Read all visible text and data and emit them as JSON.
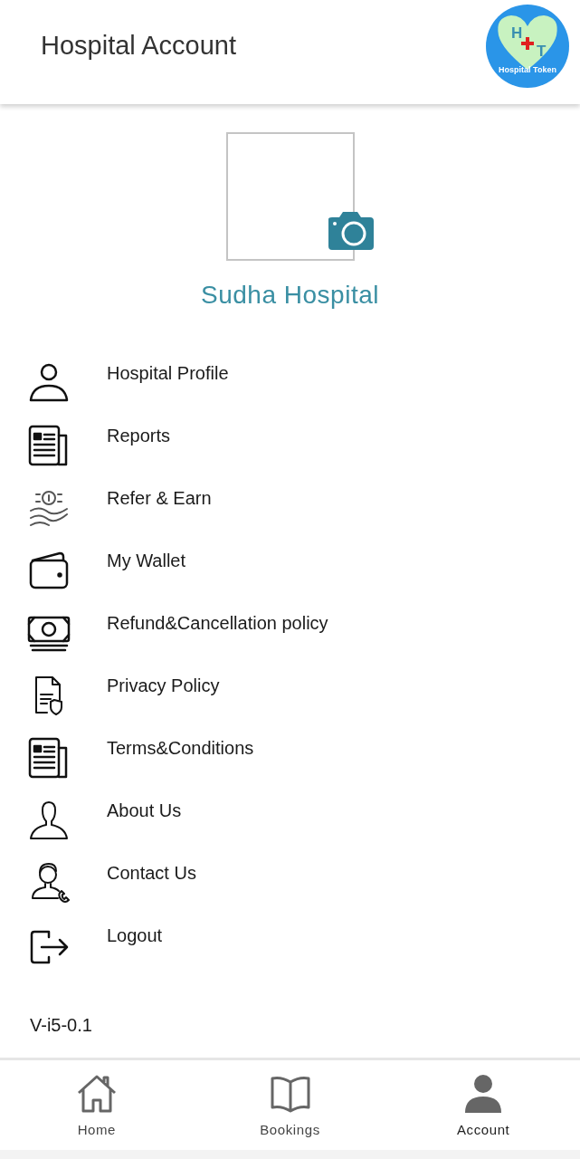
{
  "header": {
    "title": "Hospital Account",
    "logo": {
      "letters": [
        "H",
        "T"
      ],
      "caption": "Hospital Token"
    }
  },
  "profile": {
    "name": "Sudha Hospital"
  },
  "menu": [
    {
      "kind": "person",
      "label": "Hospital Profile"
    },
    {
      "kind": "newspaper",
      "label": "Reports"
    },
    {
      "kind": "coin-hand",
      "label": "Refer & Earn"
    },
    {
      "kind": "wallet",
      "label": "My Wallet"
    },
    {
      "kind": "money",
      "label": "Refund&Cancellation policy"
    },
    {
      "kind": "document-shield",
      "label": "Privacy Policy"
    },
    {
      "kind": "newspaper",
      "label": "Terms&Conditions"
    },
    {
      "kind": "user-outline",
      "label": "About Us"
    },
    {
      "kind": "support",
      "label": "Contact Us"
    },
    {
      "kind": "logout",
      "label": "Logout"
    }
  ],
  "footer": {
    "version": "V-i5-0.1"
  },
  "bottom_nav": [
    {
      "kind": "home",
      "label": "Home",
      "selected": false
    },
    {
      "kind": "book",
      "label": "Bookings",
      "selected": false
    },
    {
      "kind": "account",
      "label": "Account",
      "selected": true
    }
  ]
}
